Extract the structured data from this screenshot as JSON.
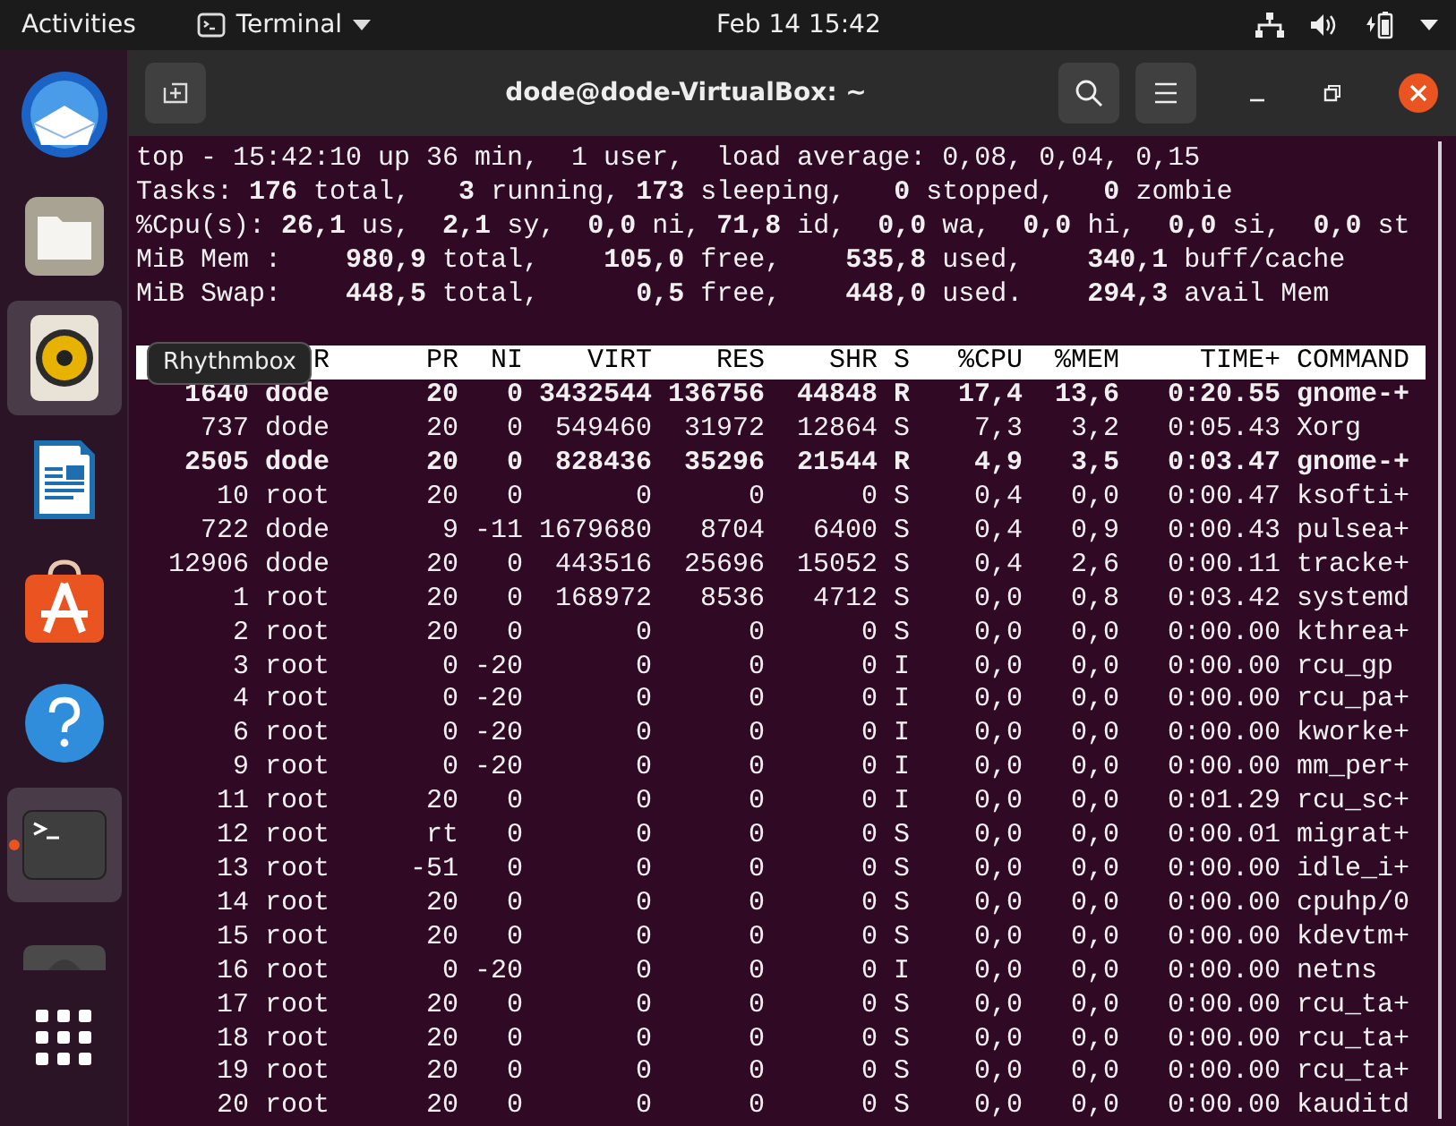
{
  "top_bar": {
    "activities": "Activities",
    "app_menu": "Terminal",
    "clock": "Feb 14  15:42"
  },
  "dock": {
    "items": [
      {
        "kind": "mail",
        "highlighted": false,
        "running": false
      },
      {
        "kind": "files",
        "highlighted": false,
        "running": false
      },
      {
        "kind": "speaker",
        "highlighted": true,
        "running": false
      },
      {
        "kind": "writer",
        "highlighted": false,
        "running": false
      },
      {
        "kind": "store",
        "highlighted": false,
        "running": false
      },
      {
        "kind": "help",
        "highlighted": false,
        "running": false
      },
      {
        "kind": "terminal",
        "highlighted": true,
        "running": true
      },
      {
        "kind": "partial",
        "highlighted": false,
        "running": false
      },
      {
        "kind": "grid",
        "highlighted": false,
        "running": false
      }
    ],
    "tooltip": "Rhythmbox"
  },
  "window": {
    "title": "dode@dode-VirtualBox: ~"
  },
  "terminal": {
    "summary": [
      "top - 15:42:10 up 36 min,  1 user,  load average: 0,08, 0,04, 0,15",
      "Tasks: **176** total,   **3** running, **173** sleeping,   **0** stopped,   **0** zombie",
      "%Cpu(s): **26,1** us,  **2,1** sy,  **0,0** ni, **71,8** id,  **0,0** wa,  **0,0** hi,  **0,0** si,  **0,0** st",
      "MiB Mem :    **980,9** total,    **105,0** free,    **535,8** used,    **340,1** buff/cache",
      "MiB Swap:    **448,5** total,      **0,5** free,    **448,0** used.    **294,3** avail Mem"
    ],
    "header": [
      "R",
      "PR",
      "NI",
      "VIRT",
      "RES",
      "SHR",
      "S",
      "%CPU",
      "%MEM",
      "TIME+",
      "COMMAND"
    ],
    "rows": [
      {
        "bold": true,
        "cells": [
          "1640",
          "dode",
          "20",
          "0",
          "3432544",
          "136756",
          "44848",
          "R",
          "17,4",
          "13,6",
          "0:20.55",
          "gnome-+"
        ]
      },
      {
        "bold": false,
        "cells": [
          "737",
          "dode",
          "20",
          "0",
          "549460",
          "31972",
          "12864",
          "S",
          "7,3",
          "3,2",
          "0:05.43",
          "Xorg"
        ]
      },
      {
        "bold": true,
        "cells": [
          "2505",
          "dode",
          "20",
          "0",
          "828436",
          "35296",
          "21544",
          "R",
          "4,9",
          "3,5",
          "0:03.47",
          "gnome-+"
        ]
      },
      {
        "bold": false,
        "cells": [
          "10",
          "root",
          "20",
          "0",
          "0",
          "0",
          "0",
          "S",
          "0,4",
          "0,0",
          "0:00.47",
          "ksofti+"
        ]
      },
      {
        "bold": false,
        "cells": [
          "722",
          "dode",
          "9",
          "-11",
          "1679680",
          "8704",
          "6400",
          "S",
          "0,4",
          "0,9",
          "0:00.43",
          "pulsea+"
        ]
      },
      {
        "bold": false,
        "cells": [
          "12906",
          "dode",
          "20",
          "0",
          "443516",
          "25696",
          "15052",
          "S",
          "0,4",
          "2,6",
          "0:00.11",
          "tracke+"
        ]
      },
      {
        "bold": false,
        "cells": [
          "1",
          "root",
          "20",
          "0",
          "168972",
          "8536",
          "4712",
          "S",
          "0,0",
          "0,8",
          "0:03.42",
          "systemd"
        ]
      },
      {
        "bold": false,
        "cells": [
          "2",
          "root",
          "20",
          "0",
          "0",
          "0",
          "0",
          "S",
          "0,0",
          "0,0",
          "0:00.00",
          "kthrea+"
        ]
      },
      {
        "bold": false,
        "cells": [
          "3",
          "root",
          "0",
          "-20",
          "0",
          "0",
          "0",
          "I",
          "0,0",
          "0,0",
          "0:00.00",
          "rcu_gp"
        ]
      },
      {
        "bold": false,
        "cells": [
          "4",
          "root",
          "0",
          "-20",
          "0",
          "0",
          "0",
          "I",
          "0,0",
          "0,0",
          "0:00.00",
          "rcu_pa+"
        ]
      },
      {
        "bold": false,
        "cells": [
          "6",
          "root",
          "0",
          "-20",
          "0",
          "0",
          "0",
          "I",
          "0,0",
          "0,0",
          "0:00.00",
          "kworke+"
        ]
      },
      {
        "bold": false,
        "cells": [
          "9",
          "root",
          "0",
          "-20",
          "0",
          "0",
          "0",
          "I",
          "0,0",
          "0,0",
          "0:00.00",
          "mm_per+"
        ]
      },
      {
        "bold": false,
        "cells": [
          "11",
          "root",
          "20",
          "0",
          "0",
          "0",
          "0",
          "I",
          "0,0",
          "0,0",
          "0:01.29",
          "rcu_sc+"
        ]
      },
      {
        "bold": false,
        "cells": [
          "12",
          "root",
          "rt",
          "0",
          "0",
          "0",
          "0",
          "S",
          "0,0",
          "0,0",
          "0:00.01",
          "migrat+"
        ]
      },
      {
        "bold": false,
        "cells": [
          "13",
          "root",
          "-51",
          "0",
          "0",
          "0",
          "0",
          "S",
          "0,0",
          "0,0",
          "0:00.00",
          "idle_i+"
        ]
      },
      {
        "bold": false,
        "cells": [
          "14",
          "root",
          "20",
          "0",
          "0",
          "0",
          "0",
          "S",
          "0,0",
          "0,0",
          "0:00.00",
          "cpuhp/0"
        ]
      },
      {
        "bold": false,
        "cells": [
          "15",
          "root",
          "20",
          "0",
          "0",
          "0",
          "0",
          "S",
          "0,0",
          "0,0",
          "0:00.00",
          "kdevtm+"
        ]
      },
      {
        "bold": false,
        "cells": [
          "16",
          "root",
          "0",
          "-20",
          "0",
          "0",
          "0",
          "I",
          "0,0",
          "0,0",
          "0:00.00",
          "netns"
        ]
      },
      {
        "bold": false,
        "cells": [
          "17",
          "root",
          "20",
          "0",
          "0",
          "0",
          "0",
          "S",
          "0,0",
          "0,0",
          "0:00.00",
          "rcu_ta+"
        ]
      },
      {
        "bold": false,
        "cells": [
          "18",
          "root",
          "20",
          "0",
          "0",
          "0",
          "0",
          "S",
          "0,0",
          "0,0",
          "0:00.00",
          "rcu_ta+"
        ]
      },
      {
        "bold": false,
        "cells": [
          "19",
          "root",
          "20",
          "0",
          "0",
          "0",
          "0",
          "S",
          "0,0",
          "0,0",
          "0:00.00",
          "rcu_ta+"
        ]
      },
      {
        "bold": false,
        "cells": [
          "20",
          "root",
          "20",
          "0",
          "0",
          "0",
          "0",
          "S",
          "0,0",
          "0,0",
          "0:00.00",
          "kauditd"
        ]
      }
    ]
  }
}
